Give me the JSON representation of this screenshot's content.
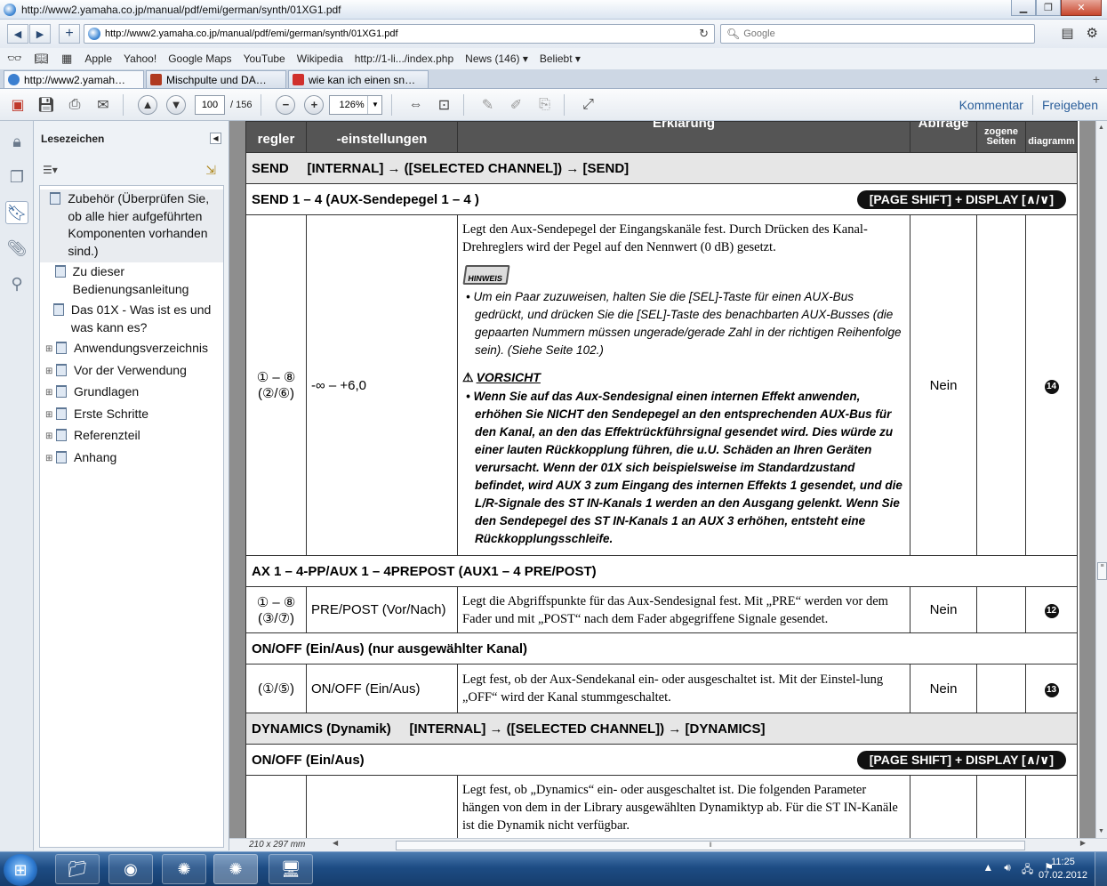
{
  "window": {
    "title": "http://www2.yamaha.co.jp/manual/pdf/emi/german/synth/01XG1.pdf"
  },
  "nav": {
    "url": "http://www2.yamaha.co.jp/manual/pdf/emi/german/synth/01XG1.pdf",
    "search_placeholder": "Google"
  },
  "bookmarks_bar": [
    "Apple",
    "Yahoo!",
    "Google Maps",
    "YouTube",
    "Wikipedia",
    "http://1-li.../index.php",
    "News (146) ▾",
    "Beliebt ▾"
  ],
  "tabs": [
    {
      "label": "http://www2.yamah…",
      "color": "#3b7fd0"
    },
    {
      "label": "Mischpulte und DA…",
      "color": "#b03a20"
    },
    {
      "label": "wie kan ich einen sn…",
      "color": "#d0302c"
    }
  ],
  "pdf_toolbar": {
    "page": "100",
    "total": "/ 156",
    "zoom": "126%",
    "comment": "Kommentar",
    "share": "Freigeben"
  },
  "bookmark_panel": {
    "title": "Lesezeichen",
    "items": [
      {
        "label": "Zubehör (Überprüfen Sie, ob alle hier aufgeführten Komponenten vorhanden sind.)",
        "expandable": false,
        "selected": true
      },
      {
        "label": "Zu dieser Bedienungsanleitung",
        "expandable": false,
        "selected": false
      },
      {
        "label": "Das 01X - Was ist es und was kann es?",
        "expandable": false,
        "selected": false
      },
      {
        "label": "Anwendungsverzeichnis",
        "expandable": true,
        "selected": false
      },
      {
        "label": "Vor der Verwendung",
        "expandable": true,
        "selected": false
      },
      {
        "label": "Grundlagen",
        "expandable": true,
        "selected": false
      },
      {
        "label": "Erste Schritte",
        "expandable": true,
        "selected": false
      },
      {
        "label": "Referenzteil",
        "expandable": true,
        "selected": false
      },
      {
        "label": "Anhang",
        "expandable": true,
        "selected": false
      }
    ]
  },
  "doc": {
    "header": {
      "c1": "regler",
      "c2": "-einstellungen",
      "c3": "Erklärung",
      "c4": "Abfrage",
      "c5": "zogene Seiten",
      "c6": "diagramm"
    },
    "send_section": "SEND     [INTERNAL] → ([SELECTED CHANNEL]) → [SEND]",
    "send_sub": "SEND 1 – 4 (AUX-Sendepegel 1 – 4 )",
    "pill": "[PAGE SHIFT] + DISPLAY [∧/∨]",
    "row1": {
      "knob": "① – ⑧",
      "knob2": "(②/⑥)",
      "range": "-∞ – +6,0",
      "desc": "Legt den Aux-Sendepegel der Eingangskanäle fest. Durch Drücken des Kanal-Drehreglers wird der Pegel auf den Nennwert (0 dB) gesetzt.",
      "hinweis": "HINWEIS",
      "note": "• Um ein Paar zuzuweisen, halten Sie die [SEL]-Taste für einen AUX-Bus gedrückt, und drücken Sie die [SEL]-Taste des benachbarten AUX-Busses (die gepaarten Nummern müssen ungerade/gerade Zahl in der richtigen Reihenfolge sein). (Siehe Seite 102.)",
      "caution_title": "VORSICHT",
      "caution": "• Wenn Sie auf das Aux-Sendesignal einen internen Effekt anwenden, erhöhen Sie NICHT den Sendepegel an den entsprechenden AUX-Bus für den Kanal, an den das Effektrückführsignal gesendet wird. Dies würde zu einer lauten Rückkopplung führen, die u.U. Schäden an Ihren Geräten verursacht. Wenn der 01X sich beispielsweise im Standardzustand befindet, wird AUX 3 zum Eingang des internen Effekts 1 gesendet, und die L/R-Signale des ST IN-Kanals 1 werden an den Ausgang gelenkt. Wenn Sie den Sendepegel des ST IN-Kanals 1 an AUX 3 erhöhen, entsteht eine Rückkopplungsschleife.",
      "query": "Nein",
      "diagram": "14"
    },
    "ax_sub": "AX 1 – 4-PP/AUX 1 – 4PREPOST (AUX1 – 4 PRE/POST)",
    "row2": {
      "knob": "① – ⑧",
      "knob2": "(③/⑦)",
      "range": "PRE/POST (Vor/Nach)",
      "desc": "Legt die Abgriffspunkte für das Aux-Sendesignal fest. Mit „PRE“ werden vor dem Fader und mit „POST“ nach dem Fader abgegriffene Signale gesendet.",
      "query": "Nein",
      "diagram": "12"
    },
    "onoff_sub": "ON/OFF (Ein/Aus) (nur ausgewählter Kanal)",
    "row3": {
      "knob": "(①/⑤)",
      "range": "ON/OFF (Ein/Aus)",
      "desc": "Legt fest, ob der Aux-Sendekanal ein- oder ausgeschaltet ist. Mit der Einstel-lung „OFF“ wird der Kanal stummgeschaltet.",
      "query": "Nein",
      "diagram": "13"
    },
    "dyn_section": "DYNAMICS (Dynamik)     [INTERNAL] → ([SELECTED CHANNEL]) → [DYNAMICS]",
    "dyn_sub": "ON/OFF (Ein/Aus)",
    "row4": {
      "desc": "Legt fest, ob „Dynamics“ ein- oder ausgeschaltet ist. Die folgenden Parameter hängen von dem in der Library ausgewählten Dynamiktyp ab. Für die ST IN-Kanäle ist die Dynamik nicht verfügbar."
    }
  },
  "status": {
    "page_size": "210 x 297 mm"
  },
  "taskbar": {
    "time": "11:25",
    "date": "07.02.2012"
  }
}
